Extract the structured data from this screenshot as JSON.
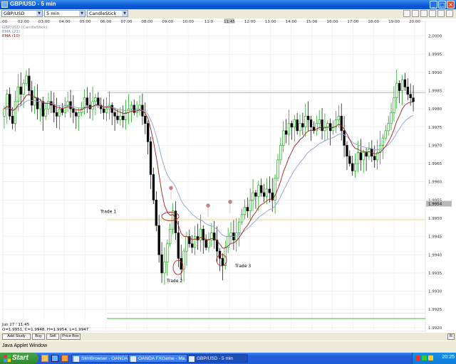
{
  "window": {
    "title": "GBP/USD - 5 min",
    "minimize": "_",
    "maximize": "□",
    "close": "×"
  },
  "toolbar": {
    "instrument": "GBP/USD",
    "interval": "5 min",
    "chart_type": "CandleStick"
  },
  "chart_data": {
    "type": "candlestick",
    "instrument": "GBP/USD",
    "interval": "5 min",
    "x_tick_labels": [
      "1:00",
      "02:00",
      "03:00",
      "04:00",
      "05:00",
      "06:00",
      "07:00",
      "08:00",
      "09:00",
      "10:00",
      "11:0",
      "11:45",
      "12:00",
      "13:00",
      "14:00",
      "15:00",
      "16:00",
      "17:00",
      "18:00",
      "19:00",
      "20:00"
    ],
    "y_tick_labels": [
      "2.0000",
      "1.9995",
      "1.9990",
      "1.9985",
      "1.9980",
      "1.9975",
      "1.9970",
      "1.9965",
      "1.9960",
      "1.9955",
      "1.9950",
      "1.9945",
      "1.9940",
      "1.9935",
      "1.9930",
      "1.9925",
      "1.9920"
    ],
    "ylim": [
      1.9919,
      2.0004
    ],
    "current_price_label": "1.9954",
    "legend": [
      "GBP/USD (CandleStick)",
      "EMA (21)",
      "EMA (10)"
    ],
    "annotations": [
      "Trade 1",
      "Trade 2",
      "Trade 3"
    ],
    "colors": {
      "up": "#00a000",
      "down": "#000000",
      "ema_slow": "#8aa0d8",
      "ema_fast": "#a02020",
      "support": "#2aaa2a",
      "entry": "#e8d870",
      "marker": "#d08080"
    },
    "closes": [
      1.998,
      1.9984,
      1.9978,
      1.9976,
      1.9982,
      1.9986,
      1.9984,
      1.9987,
      1.9989,
      1.9985,
      1.9981,
      1.9983,
      1.998,
      1.9982,
      1.9978,
      1.998,
      1.9982,
      1.9981,
      1.9979,
      1.9978,
      1.998,
      1.9979,
      1.9981,
      1.9982,
      1.998,
      1.9979,
      1.9978,
      1.9979,
      1.998,
      1.9983,
      1.9981,
      1.998,
      1.9982,
      1.9983,
      1.9981,
      1.998,
      1.9979,
      1.998,
      1.9981,
      1.9979,
      1.9978,
      1.9977,
      1.9978,
      1.9977,
      1.9979,
      1.998,
      1.9981,
      1.9979,
      1.998,
      1.9981,
      1.9978,
      1.9976,
      1.9971,
      1.9962,
      1.9955,
      1.9948,
      1.994,
      1.9935,
      1.9938,
      1.9943,
      1.9947,
      1.9952,
      1.9946,
      1.9939,
      1.9936,
      1.9941,
      1.9945,
      1.9943,
      1.9942,
      1.9945,
      1.9944,
      1.9947,
      1.9944,
      1.9942,
      1.9944,
      1.9946,
      1.9944,
      1.9941,
      1.9939,
      1.9937,
      1.9942,
      1.9945,
      1.9946,
      1.9944,
      1.9946,
      1.9949,
      1.9951,
      1.9953,
      1.9952,
      1.9955,
      1.9957,
      1.9956,
      1.9959,
      1.9957,
      1.9956,
      1.9958,
      1.9957,
      1.9955,
      1.9961,
      1.9966,
      1.997,
      1.9974,
      1.9973,
      1.9976,
      1.9975,
      1.9977,
      1.9974,
      1.9976,
      1.9975,
      1.9978,
      1.9977,
      1.9975,
      1.9974,
      1.9976,
      1.9977,
      1.9974,
      1.9975,
      1.9976,
      1.9974,
      1.9975,
      1.9977,
      1.9978,
      1.9974,
      1.997,
      1.9967,
      1.9965,
      1.9963,
      1.9965,
      1.9968,
      1.9966,
      1.9968,
      1.9967,
      1.9969,
      1.9967,
      1.9966,
      1.9968,
      1.997,
      1.9972,
      1.9974,
      1.9976,
      1.9979,
      1.9983,
      1.9987,
      1.9985,
      1.9988,
      1.9986,
      1.9984,
      1.9983,
      1.9982
    ]
  },
  "info_box": {
    "date": "Jun 27 ' 11:45",
    "ohlc": "O=1.9951, C=1.9948, H=1.9954, L=1.9947"
  },
  "buttons": {
    "add_study": "Add Study",
    "buy": "Buy",
    "sell": "Sell",
    "price_box": "Price Box",
    "r": "R"
  },
  "status": "Java Applet Window",
  "taskbar": {
    "start": "Start",
    "tasks": [
      "SlimBrowser - OANDA...",
      "OANDA FXGame - Ma...",
      "GBP/USD - 5 min"
    ],
    "clock": "20:25"
  }
}
